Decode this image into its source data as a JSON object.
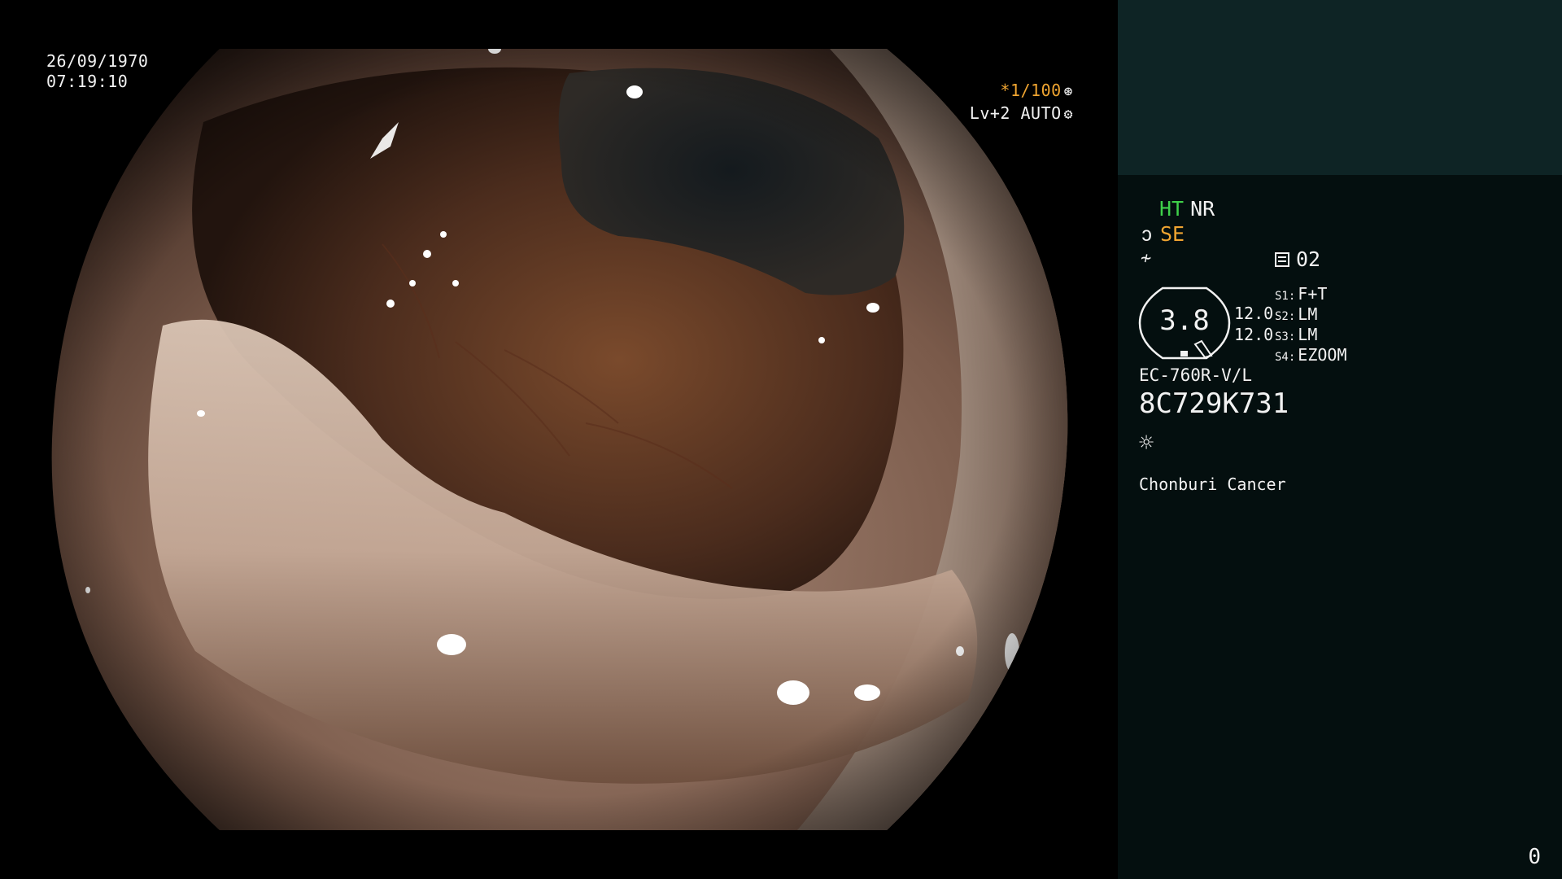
{
  "overlay": {
    "date": "26/09/1970",
    "time": "07:19:10",
    "shutter": "*1/100",
    "shutter_icon": "aperture-icon",
    "level": "Lv+2 AUTO",
    "level_icon": "iris-icon"
  },
  "panel": {
    "mode_ht": "HT",
    "mode_nr": "NR",
    "structure_enhance": "SE",
    "structure_icon": "hook-icon",
    "color_icon": "slash-icon",
    "memo_icon": "memo-icon",
    "memo_number": "02",
    "gauge_value": "3.8",
    "ratio_1": "12.0",
    "ratio_2": "12.0",
    "switches": [
      {
        "key": "S1:",
        "value": "F+T"
      },
      {
        "key": "S2:",
        "value": "LM"
      },
      {
        "key": "S3:",
        "value": "LM"
      },
      {
        "key": "S4:",
        "value": "EZOOM"
      }
    ],
    "scope_model": "EC-760R-V/L",
    "scope_serial": "8C729K731",
    "light_icon": "sun-icon",
    "hospital": "Chonburi Cancer",
    "frame_count": "0"
  },
  "colors": {
    "panel_bg": "#040f0f",
    "thumb_bg": "#0e2425",
    "accent_orange": "#f0a531",
    "accent_green": "#3fd04a",
    "text": "#f2f2f2"
  }
}
